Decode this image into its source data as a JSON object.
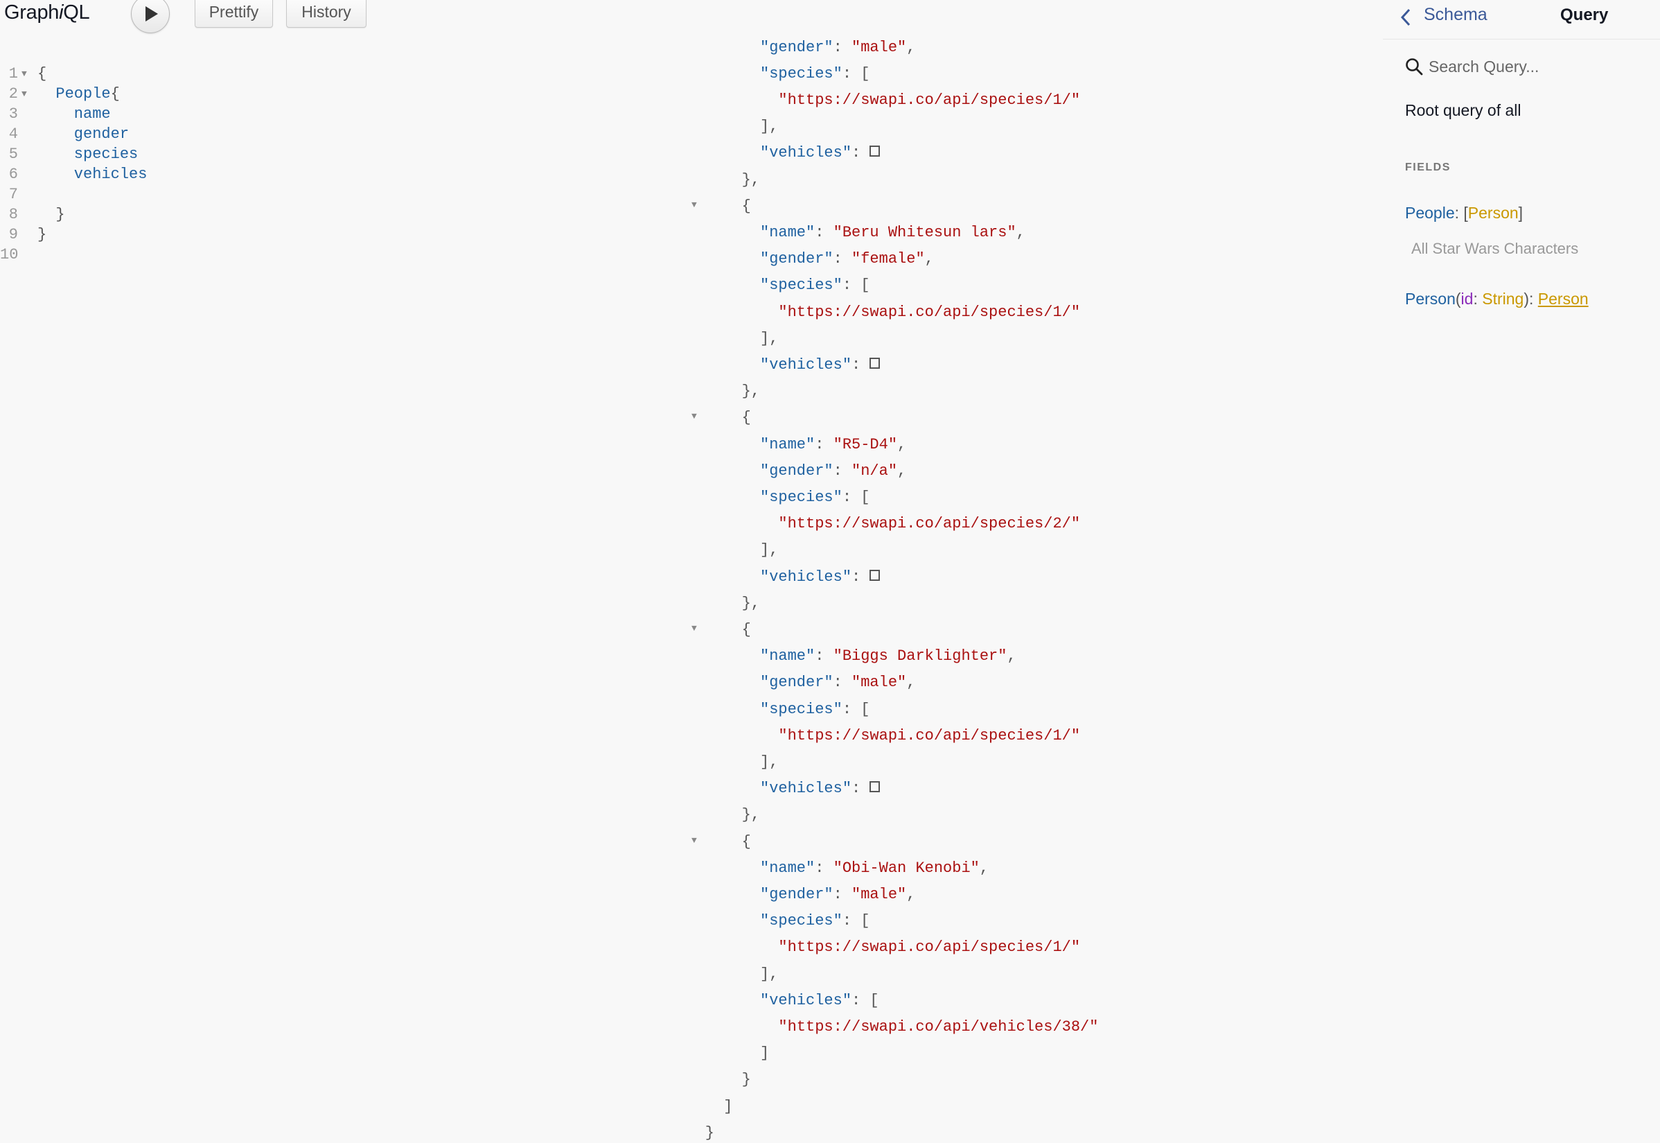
{
  "toolbar": {
    "title_pre": "Graph",
    "title_i": "i",
    "title_post": "QL",
    "run_icon": "play-icon",
    "prettify_label": "Prettify",
    "history_label": "History"
  },
  "editor": {
    "lines": [
      {
        "n": "1",
        "fold": true,
        "text": "{"
      },
      {
        "n": "2",
        "fold": true,
        "text": "  People{"
      },
      {
        "n": "3",
        "fold": false,
        "text": "    name"
      },
      {
        "n": "4",
        "fold": false,
        "text": "    gender"
      },
      {
        "n": "5",
        "fold": false,
        "text": "    species"
      },
      {
        "n": "6",
        "fold": false,
        "text": "    vehicles"
      },
      {
        "n": "7",
        "fold": false,
        "text": ""
      },
      {
        "n": "8",
        "fold": false,
        "text": "  }"
      },
      {
        "n": "9",
        "fold": false,
        "text": "}"
      },
      {
        "n": "10",
        "fold": false,
        "text": ""
      }
    ]
  },
  "result": {
    "people": [
      {
        "name": "",
        "gender": "male",
        "species": [
          "https://swapi.co/api/species/1/"
        ],
        "vehicles": []
      },
      {
        "name": "Beru Whitesun lars",
        "gender": "female",
        "species": [
          "https://swapi.co/api/species/1/"
        ],
        "vehicles": []
      },
      {
        "name": "R5-D4",
        "gender": "n/a",
        "species": [
          "https://swapi.co/api/species/2/"
        ],
        "vehicles": []
      },
      {
        "name": "Biggs Darklighter",
        "gender": "male",
        "species": [
          "https://swapi.co/api/species/1/"
        ],
        "vehicles": []
      },
      {
        "name": "Obi-Wan Kenobi",
        "gender": "male",
        "species": [
          "https://swapi.co/api/species/1/"
        ],
        "vehicles": [
          "https://swapi.co/api/vehicles/38/"
        ]
      }
    ]
  },
  "docs": {
    "back_label": "Schema",
    "title": "Query",
    "search_placeholder": "Search Query...",
    "description": "Root query of all",
    "fields_header": "FIELDS",
    "field1": {
      "name": "People",
      "type": "Person",
      "description": "All Star Wars Characters"
    },
    "field2": {
      "name": "Person",
      "arg_name": "id",
      "arg_type": "String",
      "type": "Person"
    }
  }
}
